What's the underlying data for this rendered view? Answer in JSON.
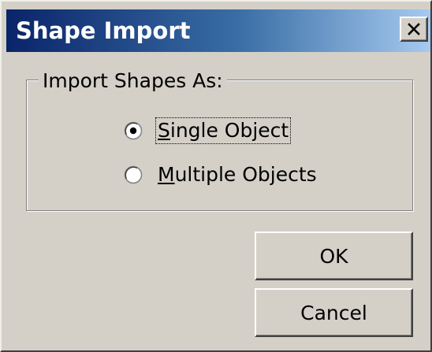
{
  "window": {
    "title": "Shape Import",
    "close_symbol": "✕"
  },
  "group": {
    "label": "Import Shapes As:",
    "options": [
      {
        "label": "Single Object",
        "selected": true,
        "focused": true,
        "mnemonic": "S"
      },
      {
        "label": "Multiple Objects",
        "selected": false,
        "focused": false,
        "mnemonic": "M"
      }
    ]
  },
  "buttons": {
    "ok_label": "OK",
    "cancel_label": "Cancel"
  },
  "colors": {
    "face": "#d4d0c8",
    "title_start": "#0a246a",
    "title_end": "#a6caf0"
  },
  "icons": {
    "close": "close-icon",
    "radio_selected": "radio-selected-icon",
    "radio_unselected": "radio-unselected-icon"
  }
}
